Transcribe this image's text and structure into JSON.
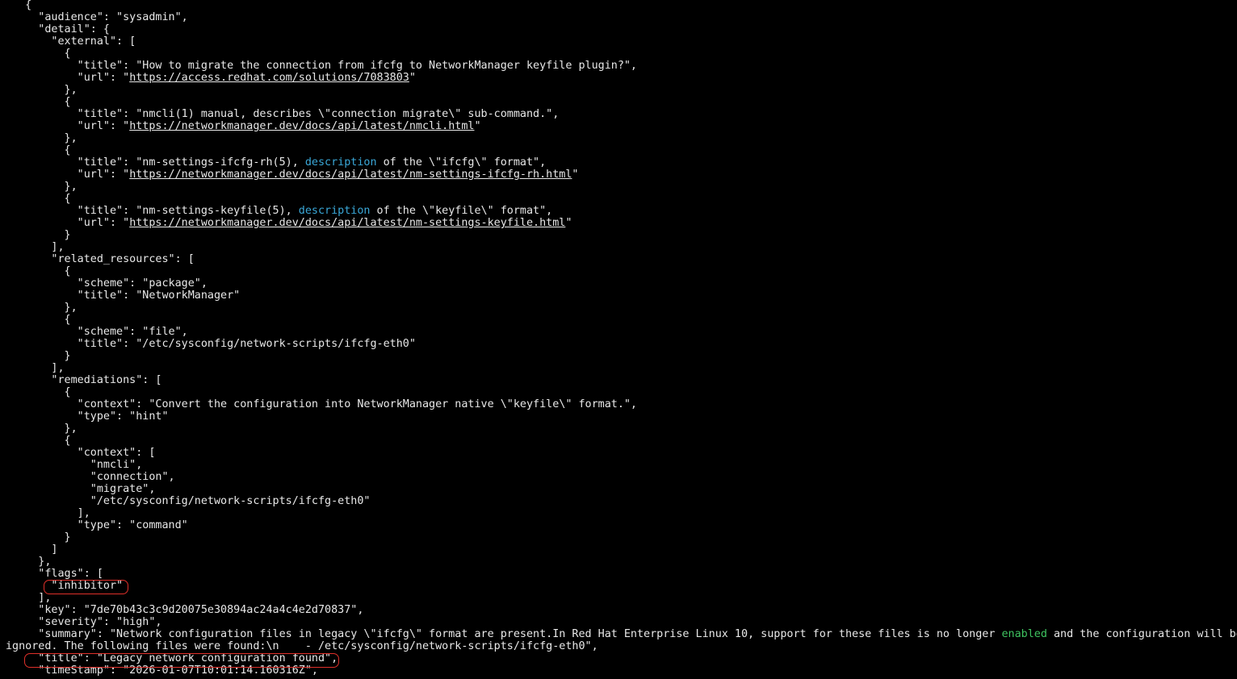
{
  "terminal": {
    "lines": [
      {
        "segments": [
          {
            "t": "   {"
          }
        ]
      },
      {
        "segments": [
          {
            "t": "     \"audience\": \"sysadmin\","
          }
        ]
      },
      {
        "segments": [
          {
            "t": "     \"detail\": {"
          }
        ]
      },
      {
        "segments": [
          {
            "t": "       \"external\": ["
          }
        ]
      },
      {
        "segments": [
          {
            "t": "         {"
          }
        ]
      },
      {
        "segments": [
          {
            "t": "           \"title\": \"How to migrate the connection from ifcfg to NetworkManager keyfile plugin?\","
          }
        ]
      },
      {
        "segments": [
          {
            "t": "           \"url\": \""
          },
          {
            "t": "https://access.redhat.com/solutions/7083803",
            "link": true
          },
          {
            "t": "\""
          }
        ]
      },
      {
        "segments": [
          {
            "t": "         },"
          }
        ]
      },
      {
        "segments": [
          {
            "t": "         {"
          }
        ]
      },
      {
        "segments": [
          {
            "t": "           \"title\": \"nmcli(1) manual, describes \\\"connection migrate\\\" sub-command.\","
          }
        ]
      },
      {
        "segments": [
          {
            "t": "           \"url\": \""
          },
          {
            "t": "https://networkmanager.dev/docs/api/latest/nmcli.html",
            "link": true
          },
          {
            "t": "\""
          }
        ]
      },
      {
        "segments": [
          {
            "t": "         },"
          }
        ]
      },
      {
        "segments": [
          {
            "t": "         {"
          }
        ]
      },
      {
        "segments": [
          {
            "t": "           \"title\": \"nm-settings-ifcfg-rh(5), "
          },
          {
            "t": "description",
            "color": "cyan"
          },
          {
            "t": " of the \\\"ifcfg\\\" format\","
          }
        ]
      },
      {
        "segments": [
          {
            "t": "           \"url\": \""
          },
          {
            "t": "https://networkmanager.dev/docs/api/latest/nm-settings-ifcfg-rh.html",
            "link": true
          },
          {
            "t": "\""
          }
        ]
      },
      {
        "segments": [
          {
            "t": "         },"
          }
        ]
      },
      {
        "segments": [
          {
            "t": "         {"
          }
        ]
      },
      {
        "segments": [
          {
            "t": "           \"title\": \"nm-settings-keyfile(5), "
          },
          {
            "t": "description",
            "color": "cyan"
          },
          {
            "t": " of the \\\"keyfile\\\" format\","
          }
        ]
      },
      {
        "segments": [
          {
            "t": "           \"url\": \""
          },
          {
            "t": "https://networkmanager.dev/docs/api/latest/nm-settings-keyfile.html",
            "link": true
          },
          {
            "t": "\""
          }
        ]
      },
      {
        "segments": [
          {
            "t": "         }"
          }
        ]
      },
      {
        "segments": [
          {
            "t": "       ],"
          }
        ]
      },
      {
        "segments": [
          {
            "t": "       \"related_resources\": ["
          }
        ]
      },
      {
        "segments": [
          {
            "t": "         {"
          }
        ]
      },
      {
        "segments": [
          {
            "t": "           \"scheme\": \"package\","
          }
        ]
      },
      {
        "segments": [
          {
            "t": "           \"title\": \"NetworkManager\""
          }
        ]
      },
      {
        "segments": [
          {
            "t": "         },"
          }
        ]
      },
      {
        "segments": [
          {
            "t": "         {"
          }
        ]
      },
      {
        "segments": [
          {
            "t": "           \"scheme\": \"file\","
          }
        ]
      },
      {
        "segments": [
          {
            "t": "           \"title\": \"/etc/sysconfig/network-scripts/ifcfg-eth0\""
          }
        ]
      },
      {
        "segments": [
          {
            "t": "         }"
          }
        ]
      },
      {
        "segments": [
          {
            "t": "       ],"
          }
        ]
      },
      {
        "segments": [
          {
            "t": "       \"remediations\": ["
          }
        ]
      },
      {
        "segments": [
          {
            "t": "         {"
          }
        ]
      },
      {
        "segments": [
          {
            "t": "           \"context\": \"Convert the configuration into NetworkManager native \\\"keyfile\\\" format.\","
          }
        ]
      },
      {
        "segments": [
          {
            "t": "           \"type\": \"hint\""
          }
        ]
      },
      {
        "segments": [
          {
            "t": "         },"
          }
        ]
      },
      {
        "segments": [
          {
            "t": "         {"
          }
        ]
      },
      {
        "segments": [
          {
            "t": "           \"context\": ["
          }
        ]
      },
      {
        "segments": [
          {
            "t": "             \"nmcli\","
          }
        ]
      },
      {
        "segments": [
          {
            "t": "             \"connection\","
          }
        ]
      },
      {
        "segments": [
          {
            "t": "             \"migrate\","
          }
        ]
      },
      {
        "segments": [
          {
            "t": "             \"/etc/sysconfig/network-scripts/ifcfg-eth0\""
          }
        ]
      },
      {
        "segments": [
          {
            "t": "           ],"
          }
        ]
      },
      {
        "segments": [
          {
            "t": "           \"type\": \"command\""
          }
        ]
      },
      {
        "segments": [
          {
            "t": "         }"
          }
        ]
      },
      {
        "segments": [
          {
            "t": "       ]"
          }
        ]
      },
      {
        "segments": [
          {
            "t": "     },"
          }
        ]
      },
      {
        "segments": [
          {
            "t": "     \"flags\": ["
          }
        ]
      },
      {
        "segments": [
          {
            "t": "       \"inhibitor\""
          }
        ]
      },
      {
        "segments": [
          {
            "t": "     ],"
          }
        ]
      },
      {
        "segments": [
          {
            "t": "     \"key\": \"7de70b43c3c9d20075e30894ac24a4c4e2d70837\","
          }
        ]
      },
      {
        "segments": [
          {
            "t": "     \"severity\": \"high\","
          }
        ]
      },
      {
        "segments": [
          {
            "t": "     \"summary\": \"Network configuration files in legacy \\\"ifcfg\\\" format are present.In Red Hat Enterprise Linux 10, support for these files is no longer "
          },
          {
            "t": "enabled",
            "color": "green"
          },
          {
            "t": " and the configuration will be"
          }
        ]
      },
      {
        "segments": [
          {
            "t": "ignored. The following files were found:\\n    - /etc/sysconfig/network-scripts/ifcfg-eth0\","
          }
        ]
      },
      {
        "segments": [
          {
            "t": "     \"title\": \"Legacy network configuration found\","
          }
        ]
      },
      {
        "segments": [
          {
            "t": "     \"timeStamp\": \"2026-01-07T10:01:14.160316Z\","
          }
        ]
      }
    ],
    "highlights": [
      {
        "label": "inhibitor-highlight",
        "color": "#e0302a"
      },
      {
        "label": "title-highlight",
        "color": "#e0302a"
      }
    ],
    "colors": {
      "background": "#000000",
      "foreground": "#e8e8e8",
      "keyword_cyan": "#3aa8d8",
      "keyword_green": "#3fc460",
      "highlight_border": "#e0302a"
    }
  }
}
